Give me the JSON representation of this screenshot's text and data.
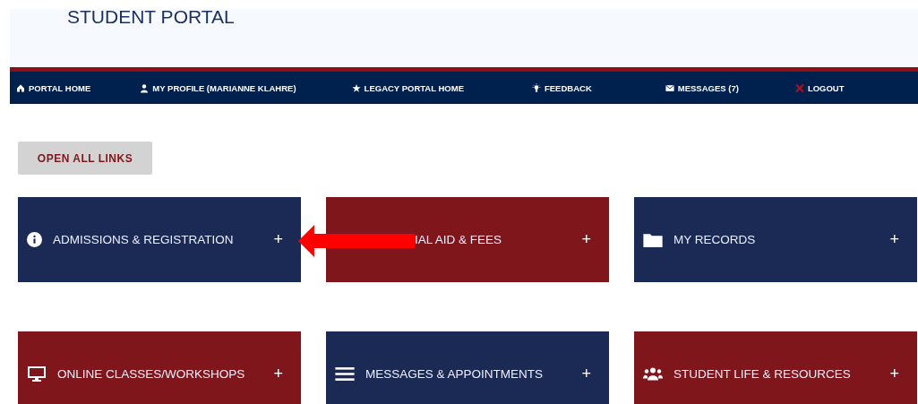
{
  "header": {
    "title": "STUDENT PORTAL"
  },
  "nav": [
    {
      "label": "PORTAL HOME"
    },
    {
      "label": "MY PROFILE (MARIANNE KLAHRE)"
    },
    {
      "label": "LEGACY PORTAL HOME"
    },
    {
      "label": "FEEDBACK"
    },
    {
      "label": "MESSAGES (7)"
    },
    {
      "label": "LOGOUT"
    }
  ],
  "open_all_button": "OPEN ALL LINKS",
  "tiles": [
    {
      "label": "ADMISSIONS & REGISTRATION",
      "color": "#1b2a55",
      "expand": "+"
    },
    {
      "label": "IAL AID & FEES",
      "color": "#7e161c",
      "expand": "+"
    },
    {
      "label": "MY RECORDS",
      "color": "#1b2a55",
      "expand": "+"
    },
    {
      "label": "ONLINE CLASSES/WORKSHOPS",
      "color": "#7e161c",
      "expand": "+"
    },
    {
      "label": "MESSAGES & APPOINTMENTS",
      "color": "#1b2a55",
      "expand": "+"
    },
    {
      "label": "STUDENT LIFE & RESOURCES",
      "color": "#7e161c",
      "expand": "+"
    }
  ]
}
